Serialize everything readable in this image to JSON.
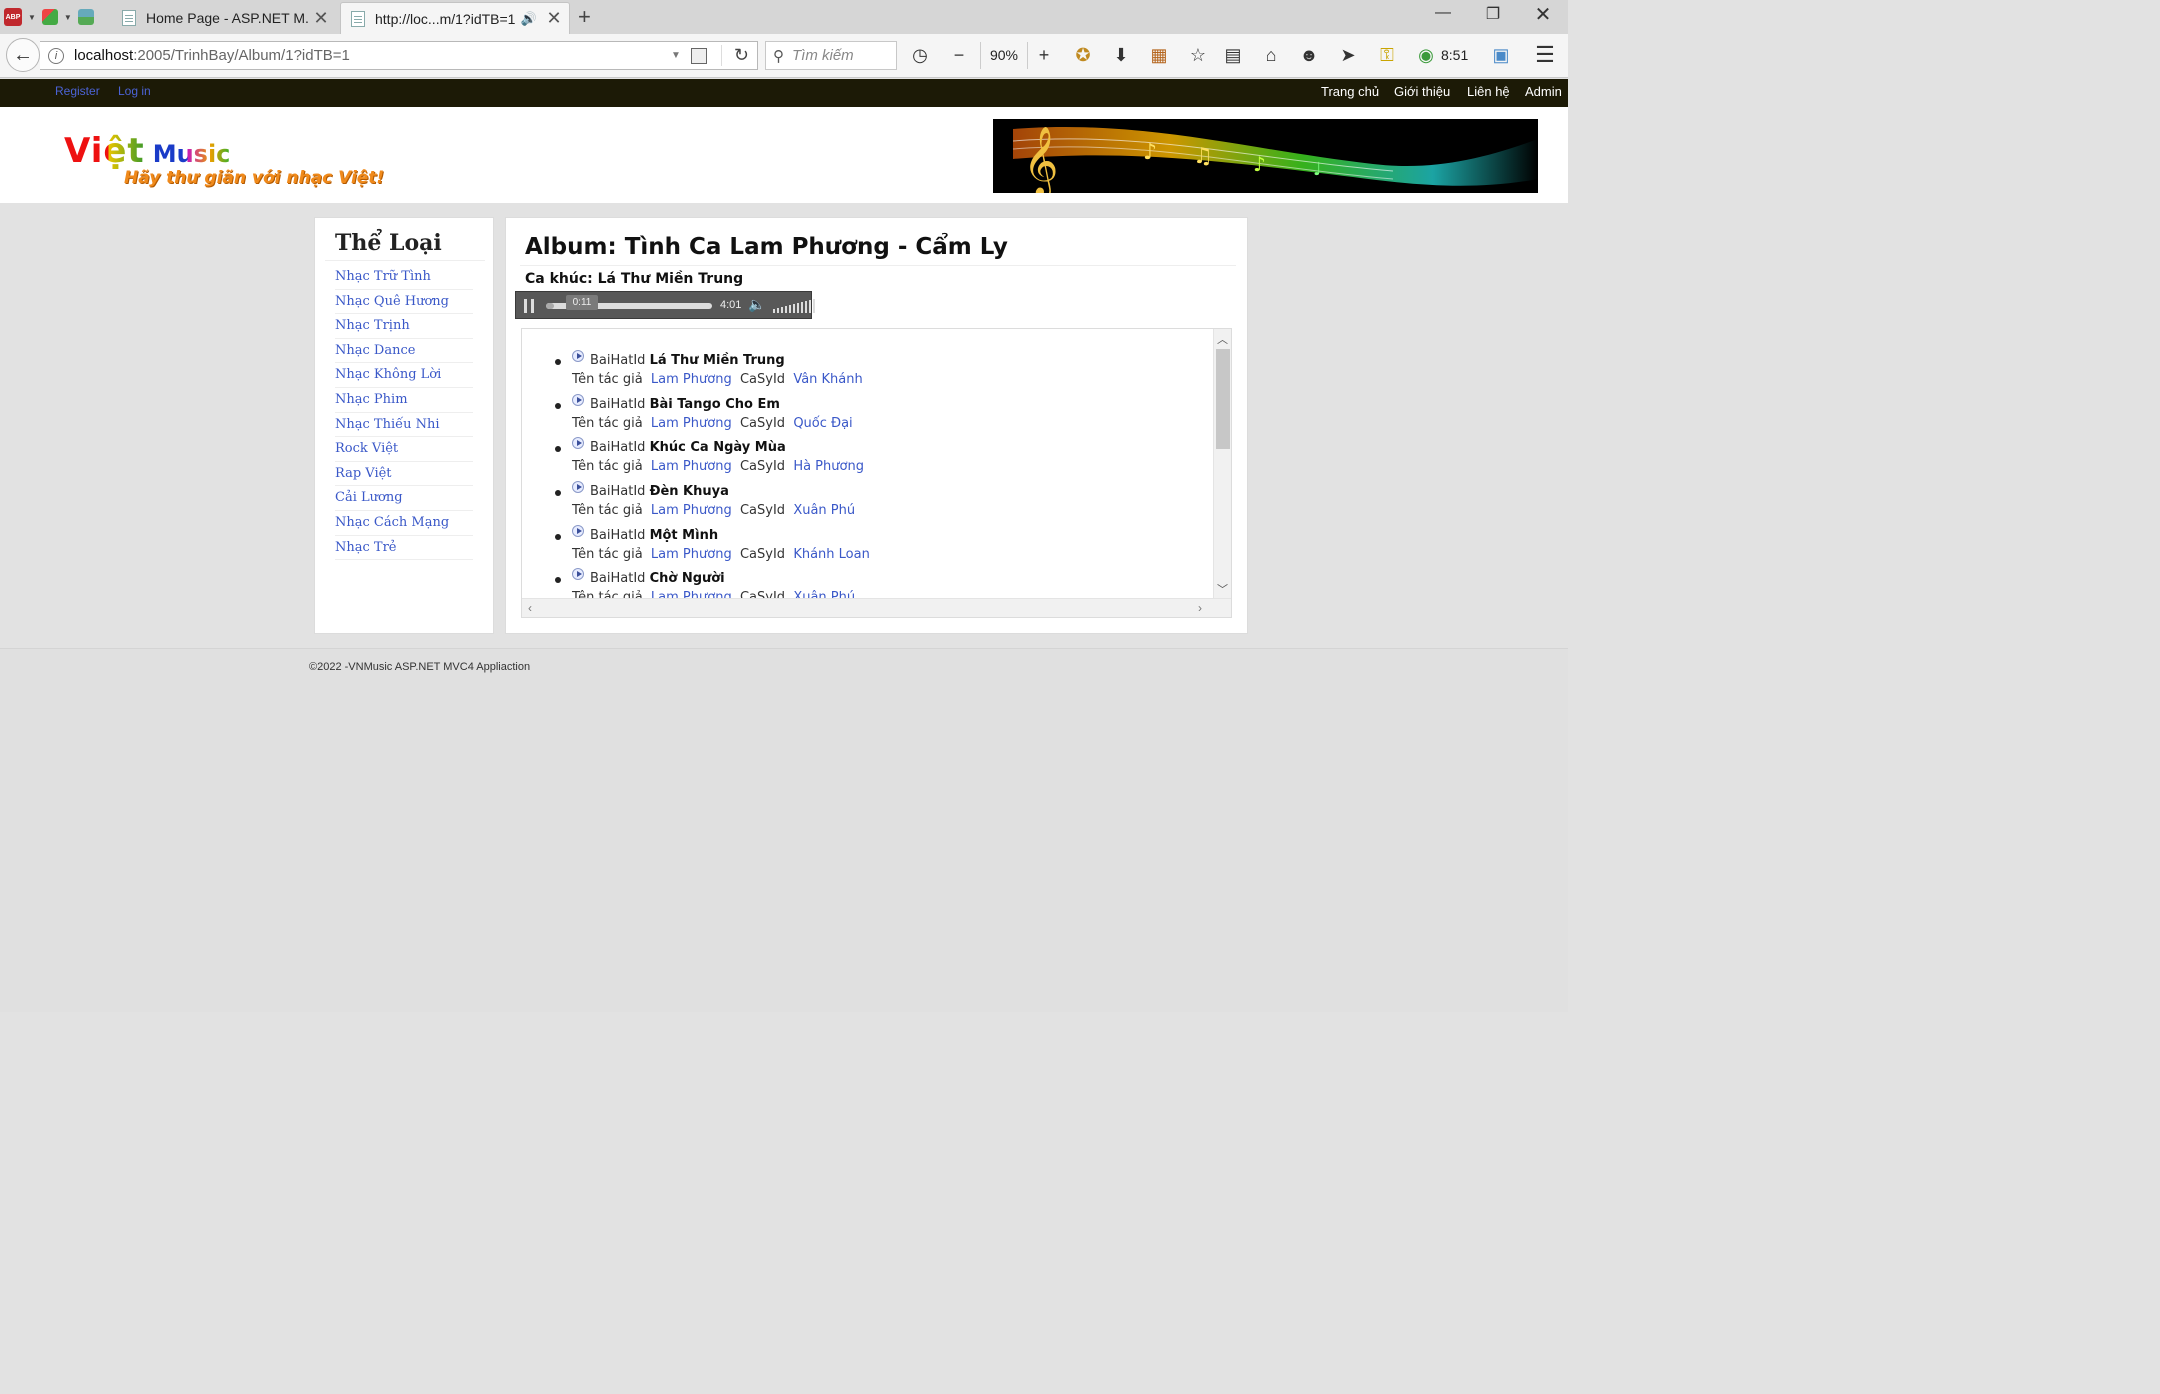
{
  "browser": {
    "tabs": [
      {
        "title": "Home Page - ASP.NET M...",
        "active": false
      },
      {
        "title": "http://loc...m/1?idTB=1",
        "active": true
      }
    ],
    "url_host": "localhost",
    "url_path": ":2005/TrinhBay/Album/1?idTB=1",
    "search_placeholder": "Tìm kiếm",
    "zoom": "90%",
    "time": "8:51",
    "abp_label": "ABP"
  },
  "site": {
    "account_links": {
      "register": "Register",
      "login": "Log in"
    },
    "main_nav": [
      "Trang chủ",
      "Giới thiệu",
      "Liên hệ",
      "Admin"
    ],
    "logo": {
      "viet": "Việt",
      "music": "Music",
      "tagline": "Hãy thư giãn với nhạc Việt!"
    },
    "sidebar": {
      "title": "Thể Loại",
      "items": [
        "Nhạc Trữ Tình",
        "Nhạc Quê Hương",
        "Nhạc Trịnh",
        "Nhạc Dance",
        "Nhạc Không Lời",
        "Nhạc Phim",
        "Nhạc Thiếu Nhi",
        "Rock Việt",
        "Rap Việt",
        "Cải Lương",
        "Nhạc Cách Mạng",
        "Nhạc Trẻ"
      ]
    },
    "album_title": "Album: Tình Ca Lam Phương - Cẩm Ly",
    "song_title": "Ca khúc: Lá Thư Miền Trung",
    "player": {
      "current": "0:11",
      "duration": "4:01",
      "progress": 0.046
    },
    "labels": {
      "song_id": "BaiHatId",
      "author": "Tên tác giả",
      "singer": "CaSyId"
    },
    "songs": [
      {
        "name": "Lá Thư Miền Trung",
        "author": "Lam Phương",
        "singer": "Vân Khánh"
      },
      {
        "name": "Bài Tango Cho Em",
        "author": "Lam Phương",
        "singer": "Quốc Đại"
      },
      {
        "name": "Khúc Ca Ngày Mùa",
        "author": "Lam Phương",
        "singer": "Hà Phương"
      },
      {
        "name": "Đèn Khuya",
        "author": "Lam Phương",
        "singer": "Xuân Phú"
      },
      {
        "name": "Một Mình",
        "author": "Lam Phương",
        "singer": "Khánh Loan"
      },
      {
        "name": "Chờ Người",
        "author": "Lam Phương",
        "singer": "Xuân Phú"
      }
    ],
    "footer": "©2022 -VNMusic ASP.NET MVC4 Appliaction"
  }
}
